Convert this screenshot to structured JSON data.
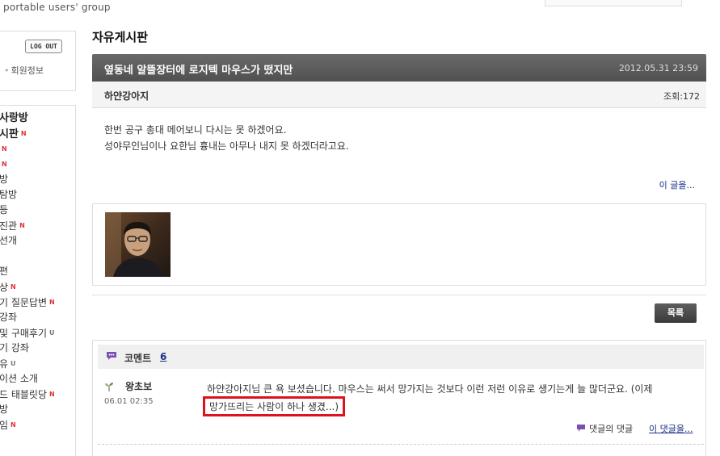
{
  "header": {
    "logo_subtitle": "portable users' group"
  },
  "sidebar": {
    "logout_label": "LOG OUT",
    "member_info_label": "회원정보",
    "menu": [
      {
        "label": "사랑방",
        "style": "head",
        "badge": ""
      },
      {
        "label": "시판",
        "style": "head",
        "badge": "N"
      },
      {
        "label": "",
        "style": "",
        "badge": "N"
      },
      {
        "label": "",
        "style": "",
        "badge": "N"
      },
      {
        "label": "방",
        "style": "",
        "badge": ""
      },
      {
        "label": "탐방",
        "style": "",
        "badge": ""
      },
      {
        "label": "등",
        "style": "",
        "badge": ""
      },
      {
        "label": "진관",
        "style": "",
        "badge": "N"
      },
      {
        "label": "선개",
        "style": "",
        "badge": ""
      },
      {
        "label": "",
        "style": "",
        "badge": ""
      },
      {
        "label": "편",
        "style": "",
        "badge": ""
      },
      {
        "label": "상",
        "style": "",
        "badge": "N"
      },
      {
        "label": "기 질문답변",
        "style": "",
        "badge": "N"
      },
      {
        "label": "강좌",
        "style": "",
        "badge": ""
      },
      {
        "label": "및 구매후기",
        "style": "",
        "badge": "U"
      },
      {
        "label": "기 강좌",
        "style": "",
        "badge": ""
      },
      {
        "label": "유",
        "style": "",
        "badge": "U"
      },
      {
        "label": "이션 소개",
        "style": "",
        "badge": ""
      },
      {
        "label": "드 태블릿당",
        "style": "",
        "badge": "N"
      },
      {
        "label": "방",
        "style": "",
        "badge": ""
      },
      {
        "label": "임",
        "style": "",
        "badge": "N"
      }
    ]
  },
  "board": {
    "title": "자유게시판"
  },
  "post": {
    "subject": "옆동네 알뜰장터에 로지텍 마우스가 떴지만",
    "date": "2012.05.31  23:59",
    "author": "하얀강아지",
    "views": "조회:172",
    "body_lines": [
      "한번 공구 총대 메어보니 다시는 못 하겠어요.",
      "성야무인님이나 요한님 흉내는 아무나 내지 못 하겠더라고요."
    ],
    "this_post_link": "이 글을..."
  },
  "actions": {
    "list_button": "목록"
  },
  "comments": {
    "header_label": "코멘트",
    "count": "6",
    "items": [
      {
        "author": "왕초보",
        "date": "06.01  02:35",
        "text_line1": "하얀강아지님 큰 욕 보셨습니다. 마우스는 써서 망가지는 것보다 이런 저런 이유로 생기는게 늘 많더군요. (이제",
        "text_line2": "망가뜨리는 사람이 하나 생겼...)",
        "reply_label": "댓글의 댓글",
        "this_comment_link": "이 댓글을..."
      }
    ]
  },
  "colors": {
    "post_bar": "#555555",
    "link": "#1a2f8a",
    "highlight_border": "#e0101e",
    "new_badge": "#dd3333"
  }
}
